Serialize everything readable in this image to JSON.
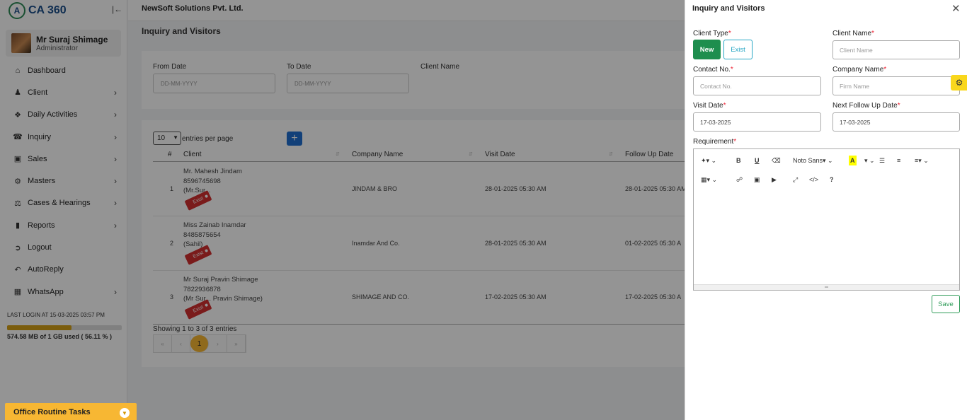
{
  "app": {
    "logo_text": "CA 360",
    "company": "NewSoft Solutions Pvt. Ltd."
  },
  "user": {
    "name": "Mr Suraj Shimage",
    "role": "Administrator"
  },
  "sidebar": {
    "items": [
      {
        "label": "Dashboard",
        "icon": "home-icon",
        "has_submenu": false
      },
      {
        "label": "Client",
        "icon": "users-icon",
        "has_submenu": true
      },
      {
        "label": "Daily Activities",
        "icon": "pin-icon",
        "has_submenu": true
      },
      {
        "label": "Inquiry",
        "icon": "phone-icon",
        "has_submenu": true
      },
      {
        "label": "Sales",
        "icon": "cash-icon",
        "has_submenu": true
      },
      {
        "label": "Masters",
        "icon": "gears-icon",
        "has_submenu": true
      },
      {
        "label": "Cases & Hearings",
        "icon": "scale-icon",
        "has_submenu": true
      },
      {
        "label": "Reports",
        "icon": "file-icon",
        "has_submenu": true
      },
      {
        "label": "Logout",
        "icon": "logout-icon",
        "has_submenu": false
      },
      {
        "label": "AutoReply",
        "icon": "reply-icon",
        "has_submenu": false
      },
      {
        "label": "WhatsApp",
        "icon": "whatsapp-icon",
        "has_submenu": true
      }
    ],
    "last_login": "LAST LOGIN AT 15-03-2025 03:57 PM",
    "storage_text": "574.58 MB of 1 GB used ( 56.11 % )",
    "storage_fraction": 0.5611,
    "office_tasks": "Office Routine Tasks"
  },
  "main": {
    "page_title": "Inquiry and Visitors",
    "filters": {
      "from_label": "From Date",
      "from_placeholder": "DD-MM-YYYY",
      "to_label": "To Date",
      "to_placeholder": "DD-MM-YYYY",
      "client_label": "Client Name"
    },
    "entries_value": "10",
    "entries_label": "entries per page",
    "add_label": "+",
    "columns": [
      "#",
      "Client",
      "Company Name",
      "Visit Date",
      "Follow Up Date"
    ],
    "rows": [
      {
        "no": "1",
        "client_lines": [
          "Mr. Mahesh Jindam",
          "8596745698",
          "(Mr.Sur..."
        ],
        "badge": "Exist",
        "company": "JINDAM & BRO",
        "visit": "28-01-2025 05:30 AM",
        "follow": "28-01-2025 05:30 AM"
      },
      {
        "no": "2",
        "client_lines": [
          "Miss Zainab Inamdar",
          "8485875654",
          "(Sahil)"
        ],
        "badge": "Exist",
        "company": "Inamdar And Co.",
        "visit": "28-01-2025 05:30 AM",
        "follow": "01-02-2025 05:30 A"
      },
      {
        "no": "3",
        "client_lines": [
          "Mr Suraj Pravin Shimage",
          "7822936878",
          "(Mr Sur... Pravin Shimage)"
        ],
        "badge": "Exist",
        "company": "SHIMAGE AND CO.",
        "visit": "17-02-2025 05:30 AM",
        "follow": "17-02-2025 05:30 A"
      }
    ],
    "showing": "Showing 1 to 3 of 3 entries",
    "pager": [
      "«",
      "‹",
      "1",
      "›",
      "»"
    ],
    "current_page": "1"
  },
  "panel": {
    "title": "Inquiry and Visitors",
    "client_type_label": "Client Type",
    "btn_new": "New",
    "btn_exist": "Exist",
    "client_name_label": "Client Name",
    "client_name_placeholder": "Client Name",
    "contact_label": "Contact No.",
    "contact_placeholder": "Contact No.",
    "company_label": "Company Name",
    "company_placeholder": "Firm Name",
    "visit_label": "Visit Date",
    "visit_value": "17-03-2025",
    "followup_label": "Next Follow Up Date",
    "followup_value": "17-03-2025",
    "requirement_label": "Requirement",
    "font_name": "Noto Sans",
    "save_label": "Save"
  },
  "colors": {
    "accent_green": "#1e8e4e",
    "info": "#26a6c4",
    "warning": "#f7b733",
    "badge_red": "#d32f2f",
    "primary_blue": "#1f6fd1"
  }
}
